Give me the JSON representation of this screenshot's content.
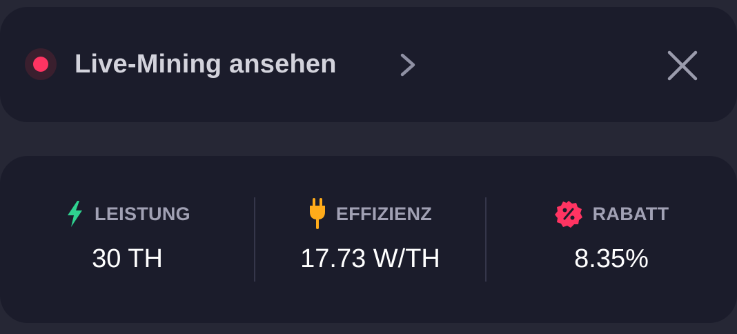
{
  "live_banner": {
    "label": "Live-Mining ansehen",
    "indicator_color": "#ff3462",
    "chevron_icon": "chevron-right-icon",
    "close_icon": "close-icon"
  },
  "stats": [
    {
      "icon": "bolt-icon",
      "icon_color": "#2fd18f",
      "label": "LEISTUNG",
      "value": "30 TH"
    },
    {
      "icon": "plug-icon",
      "icon_color": "#ffab1a",
      "label": "EFFIZIENZ",
      "value": "17.73 W/TH"
    },
    {
      "icon": "discount-badge-icon",
      "icon_color": "#ff3462",
      "label": "RABATT",
      "value": "8.35%"
    }
  ]
}
